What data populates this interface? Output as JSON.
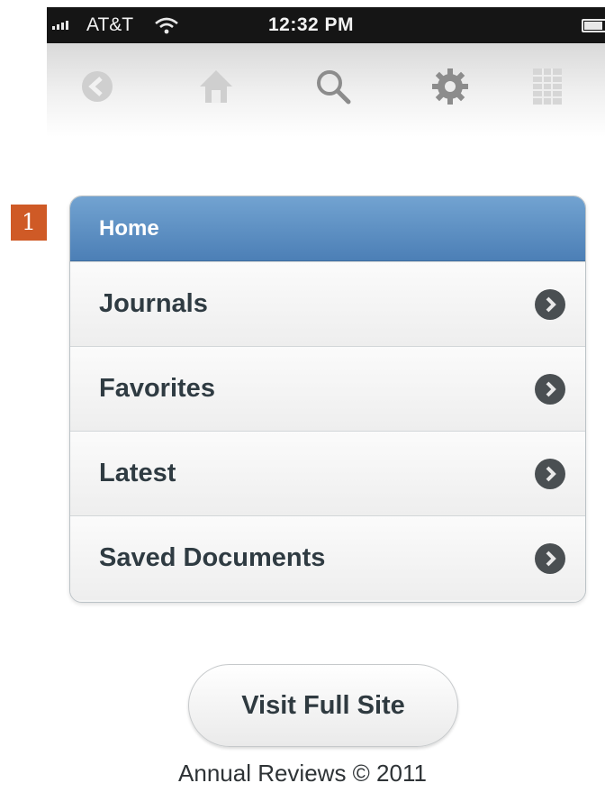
{
  "status_bar": {
    "carrier": "AT&T",
    "time": "12:32 PM"
  },
  "toolbar": {
    "icons": [
      "back-icon",
      "home-icon",
      "search-icon",
      "gear-icon",
      "grid-icon"
    ]
  },
  "annotation": {
    "step": "1"
  },
  "menu": {
    "header": "Home",
    "items": [
      {
        "label": "Journals"
      },
      {
        "label": "Favorites"
      },
      {
        "label": "Latest"
      },
      {
        "label": "Saved Documents"
      }
    ]
  },
  "footer": {
    "button_label": "Visit Full Site",
    "copyright": "Annual Reviews © 2011"
  },
  "colors": {
    "header_blue": "#5b8ec4",
    "marker_orange": "#cf5a26",
    "status_bar": "#151515"
  }
}
